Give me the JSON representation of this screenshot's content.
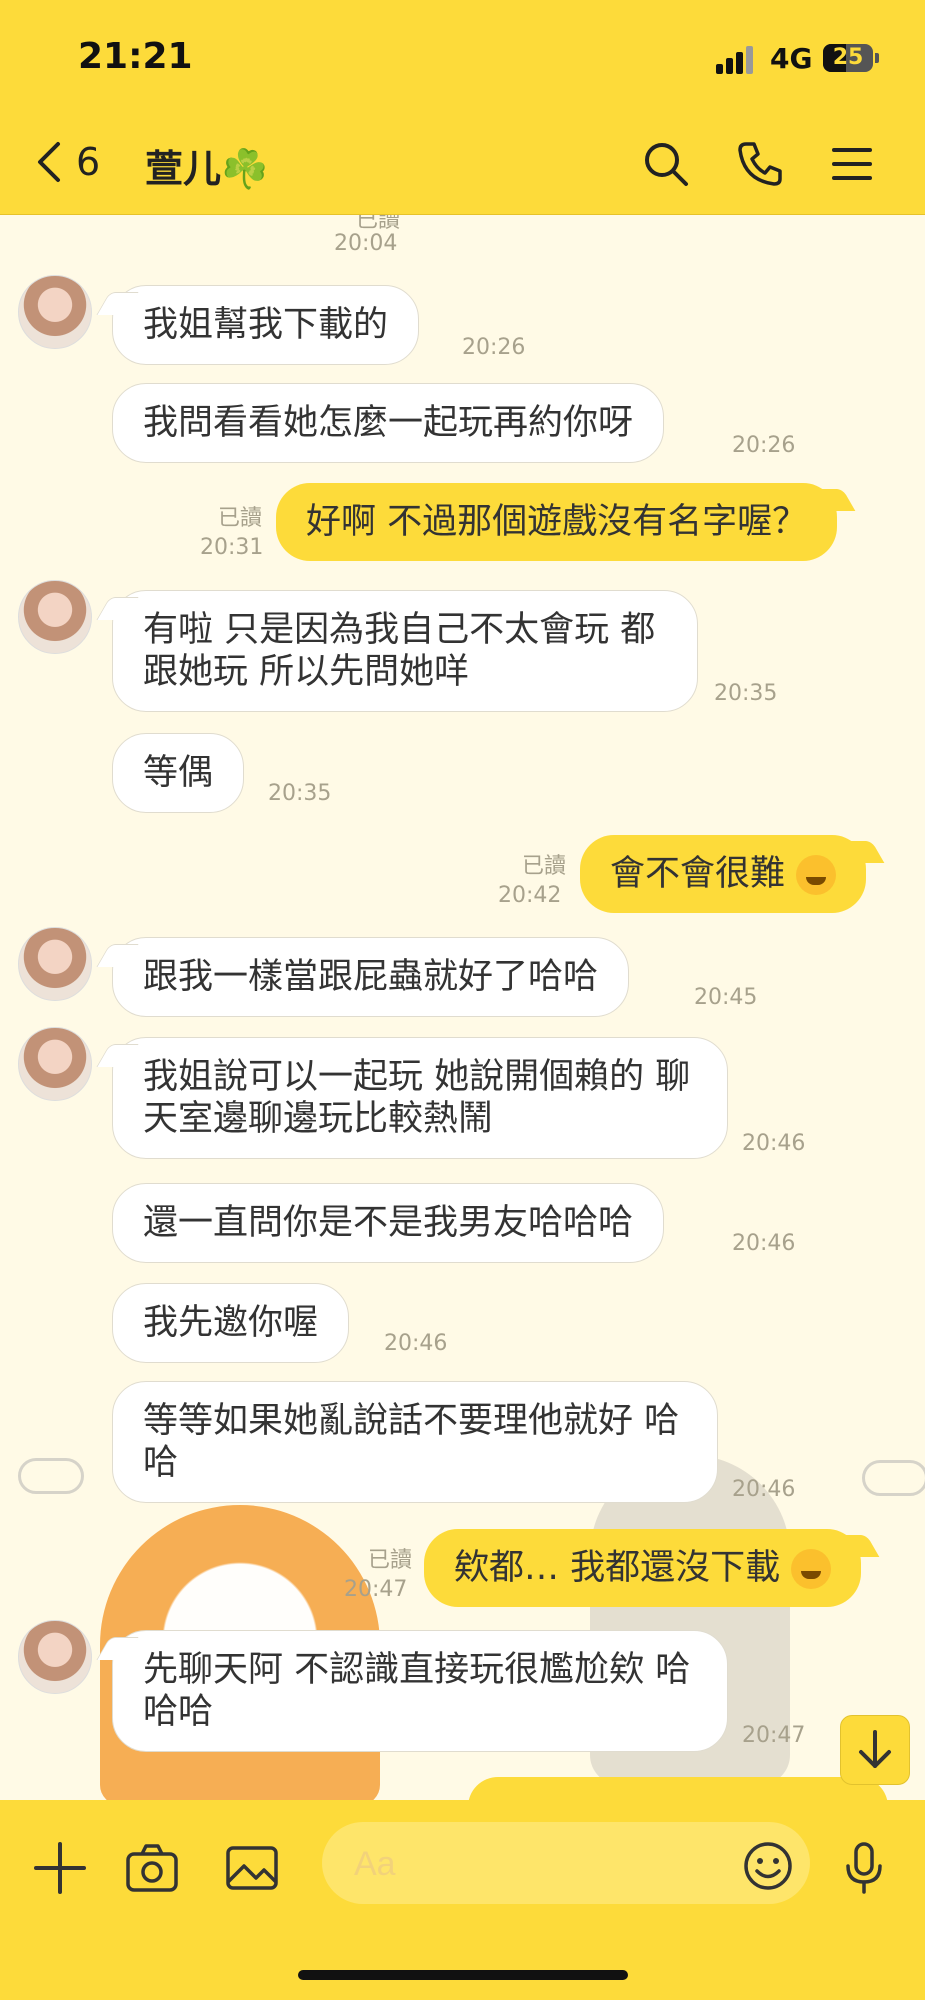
{
  "status_bar": {
    "time": "21:21",
    "network": "4G",
    "battery": "25"
  },
  "header": {
    "unread_count": "6",
    "contact_name": "萱儿☘️"
  },
  "messages": [
    {
      "read": "已讀",
      "time": "20:04"
    },
    {
      "text": "我姐幫我下載的",
      "time": "20:26"
    },
    {
      "text": "我問看看她怎麼一起玩再約你呀",
      "time": "20:26"
    },
    {
      "text": "好啊 不過那個遊戲沒有名字喔？",
      "read": "已讀",
      "time": "20:31"
    },
    {
      "text": "有啦 只是因為我自己不太會玩 都跟她玩 所以先問她咩",
      "time": "20:35"
    },
    {
      "text": "等偶",
      "time": "20:35"
    },
    {
      "text": "會不會很難",
      "read": "已讀",
      "time": "20:42"
    },
    {
      "text": "跟我一樣當跟屁蟲就好了哈哈",
      "time": "20:45"
    },
    {
      "text": "我姐說可以一起玩 她說開個賴的 聊天室邊聊邊玩比較熱鬧",
      "time": "20:46"
    },
    {
      "text": "還一直問你是不是我男友哈哈哈",
      "time": "20:46"
    },
    {
      "text": "我先邀你喔",
      "time": "20:46"
    },
    {
      "text": "等等如果她亂說話不要理他就好 哈哈",
      "time": "20:46"
    },
    {
      "text": "欸都… 我都還沒下載",
      "read": "已讀",
      "time": "20:47"
    },
    {
      "text": "先聊天阿 不認識直接玩很尷尬欸 哈哈哈",
      "time": "20:47"
    }
  ],
  "input": {
    "placeholder": "Aa",
    "value": ""
  },
  "icons": {
    "back": "chevron-left-icon",
    "search": "search-icon",
    "call": "phone-icon",
    "menu": "menu-icon",
    "add": "plus-icon",
    "camera": "camera-icon",
    "gallery": "image-icon",
    "emoji": "smiley-icon",
    "mic": "microphone-icon",
    "scroll_down": "arrow-down-icon"
  },
  "colors": {
    "accent": "#FDDB3A",
    "background": "#FFFAE6",
    "incoming_bubble": "#FFFFFF",
    "meta_text": "#A7A18C"
  }
}
